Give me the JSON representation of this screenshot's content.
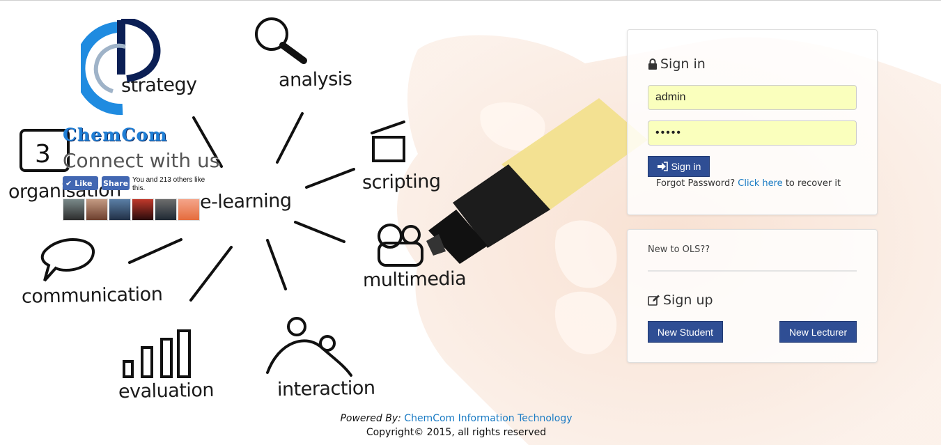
{
  "brand": {
    "name": "ChemCom",
    "connect_text": "Connect with us"
  },
  "doodle_labels": {
    "strategy": "strategy",
    "analysis": "analysis",
    "organisation": "organisation",
    "scripting": "scripting",
    "elearning": "e-learning",
    "multimedia": "multimedia",
    "communication": "communication",
    "evaluation": "evaluation",
    "interaction": "interaction"
  },
  "facebook": {
    "like_label": "Like",
    "share_label": "Share",
    "social_text": "You and 213 others like this."
  },
  "signin": {
    "title": "Sign in",
    "username_value": "admin",
    "password_value": "•••••",
    "button_label": "Sign in",
    "forgot_prefix": "Forgot Password?",
    "forgot_link": "Click here",
    "forgot_suffix": "to recover it"
  },
  "signup": {
    "new_to": "New to OLS??",
    "title": "Sign up",
    "new_student": "New Student",
    "new_lecturer": "New Lecturer"
  },
  "footer": {
    "powered_by": "Powered By:",
    "company": "ChemCom Information Technology",
    "copyright": "Copyright© 2015, all rights reserved"
  },
  "colors": {
    "primary_button": "#2f4e94",
    "link": "#1a7bc4",
    "autofill": "#faffbd",
    "facebook": "#4267b2"
  }
}
